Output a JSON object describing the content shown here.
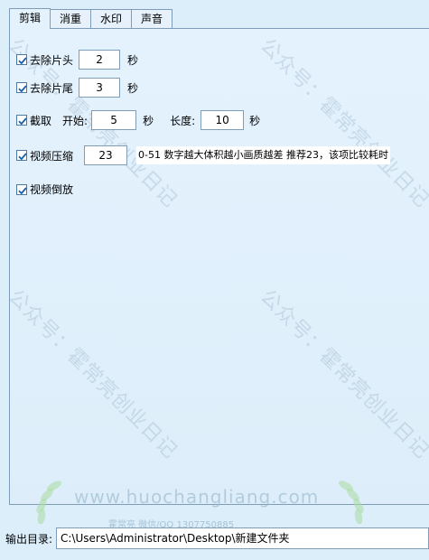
{
  "tabs": [
    {
      "label": "剪辑",
      "active": true
    },
    {
      "label": "消重",
      "active": false
    },
    {
      "label": "水印",
      "active": false
    },
    {
      "label": "声音",
      "active": false
    }
  ],
  "options": {
    "remove_head": {
      "label": "去除片头",
      "checked": true,
      "value": "2",
      "unit": "秒"
    },
    "remove_tail": {
      "label": "去除片尾",
      "checked": true,
      "value": "3",
      "unit": "秒"
    },
    "trim": {
      "label": "截取",
      "checked": true,
      "start_label": "开始:",
      "start_value": "5",
      "start_unit": "秒",
      "length_label": "长度:",
      "length_value": "10",
      "length_unit": "秒"
    },
    "compress": {
      "label": "视频压缩",
      "checked": true,
      "value": "23",
      "hint": "0-51 数字越大体积越小画质越差 推荐23，该项比较耗时"
    },
    "reverse": {
      "label": "视频倒放",
      "checked": true
    }
  },
  "output": {
    "label": "输出目录:",
    "path": "C:\\Users\\Administrator\\Desktop\\新建文件夹"
  },
  "watermark": {
    "text": "公众号：霍常亮创业日记",
    "site": "www.huochangliang.com",
    "sub": "霍常亮 微信/QQ 1307750885"
  },
  "colors": {
    "background": "#dceefa",
    "border": "#7f9db9",
    "check": "#1a5fa8"
  }
}
